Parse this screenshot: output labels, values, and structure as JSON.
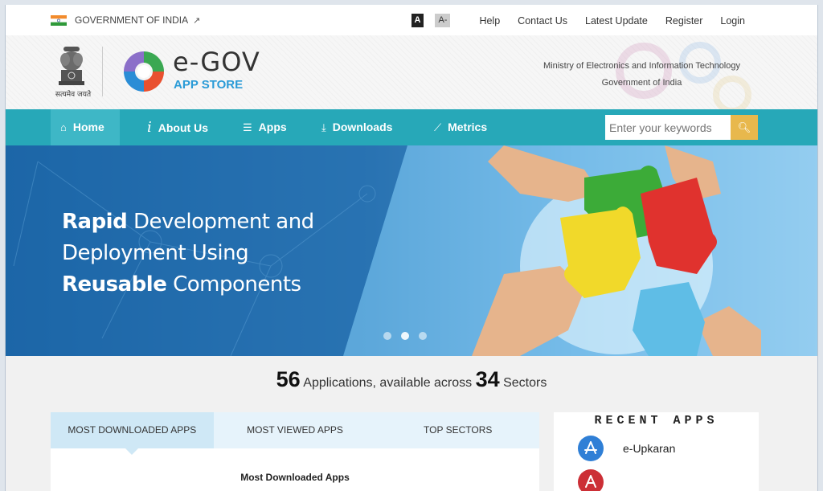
{
  "topbar": {
    "gov_label": "GOVERNMENT OF INDIA",
    "font_dark": "A",
    "font_light": "A-",
    "links": [
      "Help",
      "Contact Us",
      "Latest Update",
      "Register",
      "Login"
    ]
  },
  "header": {
    "emblem_caption": "सत्यमेव जयते",
    "brand_top": "e-GOV",
    "brand_bottom": "APP STORE",
    "ministry": "Ministry of Electronics and Information Technology",
    "government": "Government of India"
  },
  "nav": {
    "items": [
      {
        "label": "Home",
        "icon": "home-icon",
        "glyph": "⌂"
      },
      {
        "label": "About Us",
        "icon": "info-icon",
        "glyph": "i"
      },
      {
        "label": "Apps",
        "icon": "list-icon",
        "glyph": "☰"
      },
      {
        "label": "Downloads",
        "icon": "download-icon",
        "glyph": "⤓"
      },
      {
        "label": "Metrics",
        "icon": "chart-icon",
        "glyph": "⟋"
      }
    ],
    "search_placeholder": "Enter your keywords",
    "search_icon": "search-icon"
  },
  "hero": {
    "line1_bold": "Rapid",
    "line1_rest": " Development and",
    "line2": "Deployment Using",
    "line3_bold": "Reusable",
    "line3_rest": " Components",
    "slides": 3,
    "active_slide": 0
  },
  "stats": {
    "apps_count": "56",
    "text1": " Applications, available across ",
    "sectors_count": "34",
    "text2": " Sectors"
  },
  "tabs": {
    "items": [
      "MOST DOWNLOADED APPS",
      "MOST VIEWED APPS",
      "TOP SECTORS"
    ],
    "active": 0,
    "panel_title": "Most Downloaded Apps"
  },
  "recent": {
    "title": "RECENT APPS",
    "items": [
      {
        "label": "e-Upkaran",
        "color": "#2f7fd6",
        "icon": "app-store-icon"
      },
      {
        "label": "",
        "color": "#cc2f36",
        "icon": "app-icon"
      }
    ]
  },
  "colors": {
    "nav_bg": "#27a8b8",
    "nav_active": "#3eb7c6",
    "search_btn": "#e8b84d",
    "brand_blue": "#2a9bd7"
  }
}
